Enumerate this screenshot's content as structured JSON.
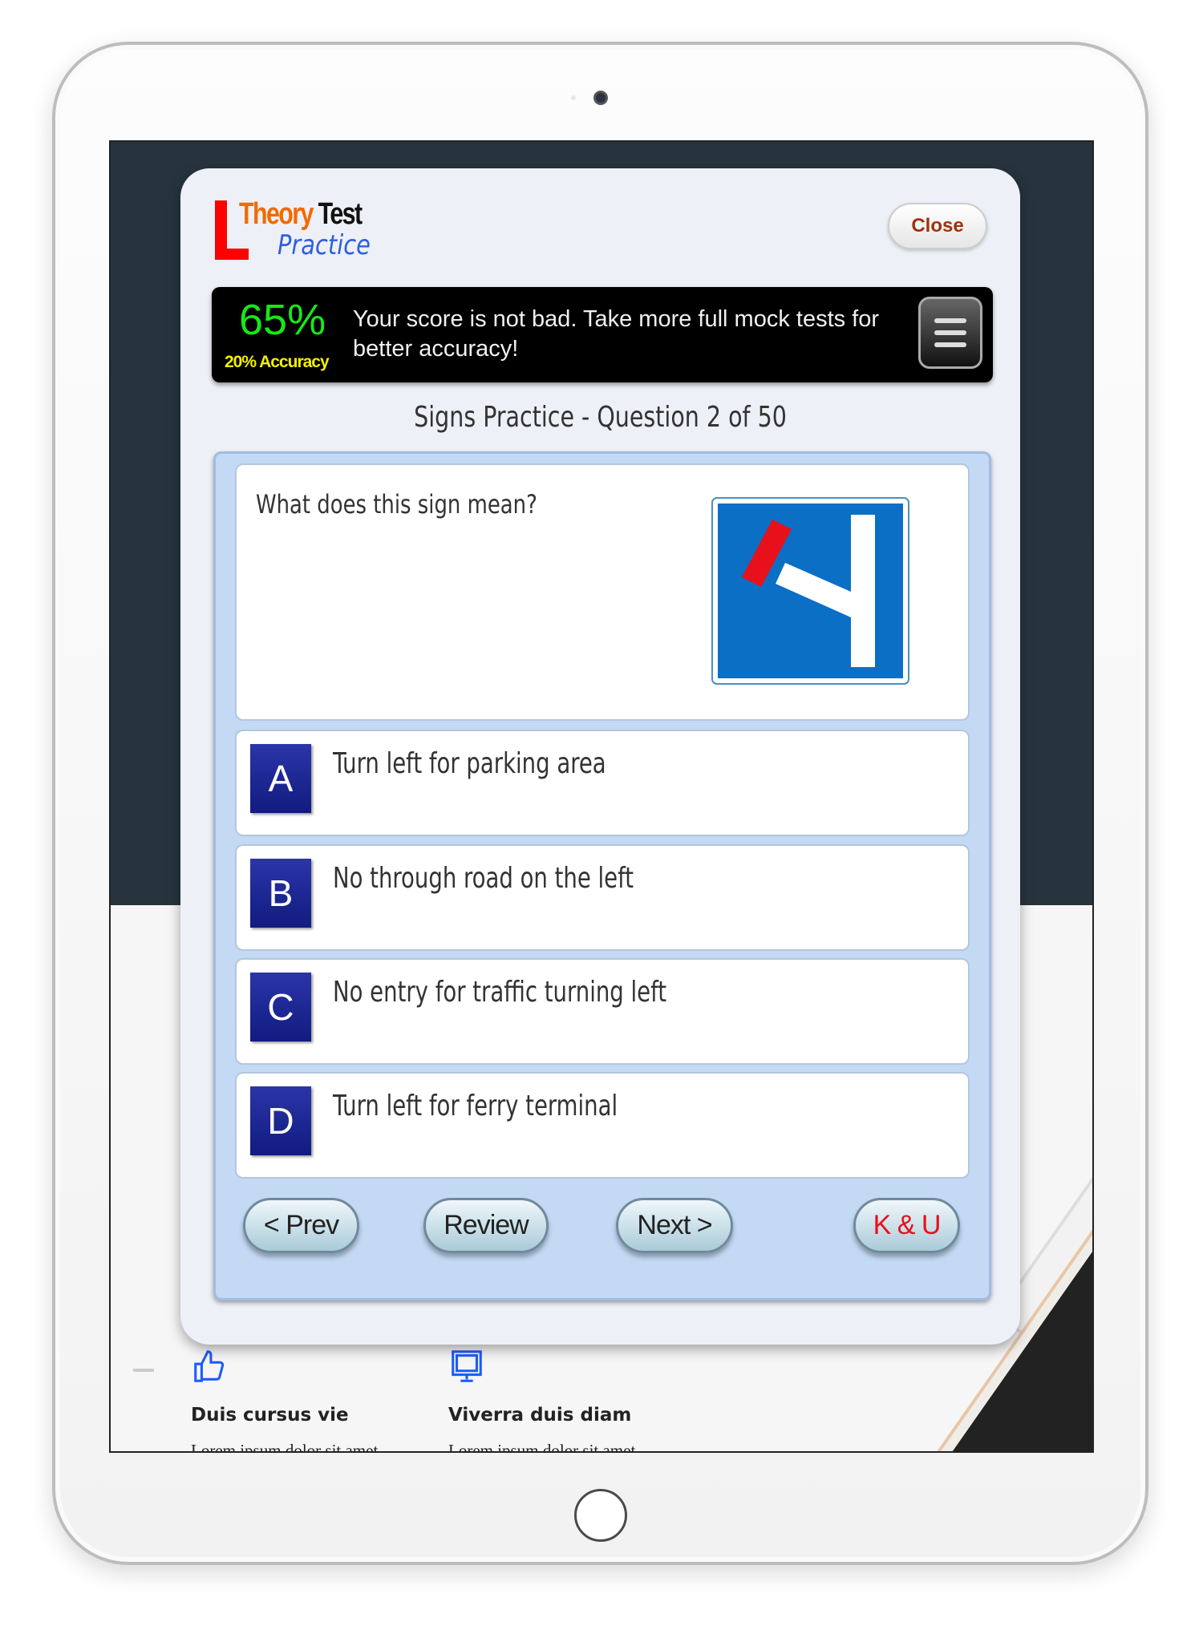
{
  "logo": {
    "word1": "Theory",
    "word2": "Test",
    "word3": "Practice"
  },
  "header": {
    "close_label": "Close"
  },
  "score": {
    "percent": "65%",
    "accuracy": "20% Accuracy",
    "message": "Your score is not bad. Take more full mock tests for better accuracy!",
    "menu_icon": "hamburger-menu-icon"
  },
  "quiz": {
    "title": "Signs Practice - Question 2 of 50",
    "question": "What does this sign mean?",
    "answers": [
      {
        "letter": "A",
        "text": "Turn left for parking area"
      },
      {
        "letter": "B",
        "text": "No through road on the left"
      },
      {
        "letter": "C",
        "text": "No entry for traffic turning left"
      },
      {
        "letter": "D",
        "text": "Turn left for ferry terminal"
      }
    ],
    "buttons": {
      "prev": "< Prev",
      "review": "Review",
      "next": "Next >",
      "ku": "K & U"
    }
  },
  "features": [
    {
      "icon": "thumbs-up-icon",
      "title": "Duis cursus vie",
      "text": "Lorem ipsum dolor sit amet,"
    },
    {
      "icon": "monitor-icon",
      "title": "Viverra duis diam",
      "text": "Lorem ipsum dolor sit amet,"
    }
  ],
  "colors": {
    "score_green": "#17e817",
    "accuracy_yellow": "#f3f000",
    "letter_blue": "#1a2490",
    "sign_blue": "#0b6fc6",
    "ku_red": "#e8101a",
    "icon_blue": "#1a5cff"
  }
}
